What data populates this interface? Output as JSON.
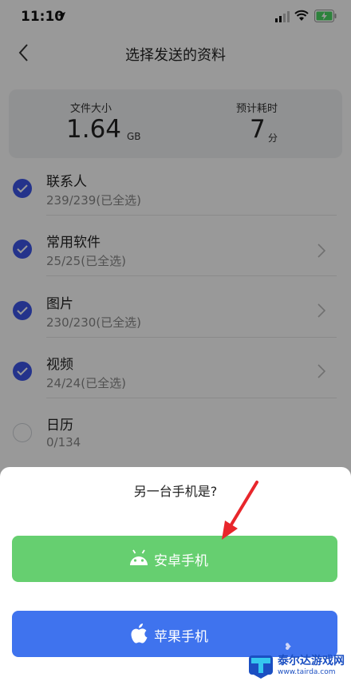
{
  "status_bar": {
    "time": "11:10"
  },
  "header": {
    "title": "选择发送的资料"
  },
  "summary": {
    "size_label": "文件大小",
    "size_value": "1.64",
    "size_unit": "GB",
    "time_label": "预计耗时",
    "time_value": "7",
    "time_unit": "分"
  },
  "items": [
    {
      "title": "联系人",
      "subtitle": "239/239(已全选)",
      "checked": true,
      "has_chevron": false
    },
    {
      "title": "常用软件",
      "subtitle": "25/25(已全选)",
      "checked": true,
      "has_chevron": true
    },
    {
      "title": "图片",
      "subtitle": "230/230(已全选)",
      "checked": true,
      "has_chevron": true
    },
    {
      "title": "视频",
      "subtitle": "24/24(已全选)",
      "checked": true,
      "has_chevron": true
    },
    {
      "title": "日历",
      "subtitle": "0/134",
      "checked": false,
      "has_chevron": false
    }
  ],
  "sheet": {
    "title": "另一台手机是?",
    "android_label": "安卓手机",
    "apple_label": "苹果手机"
  },
  "colors": {
    "check_accent": "#3d56e8",
    "android_button": "#66cf70",
    "apple_button": "#3f73ee",
    "annotation_arrow": "#e8262b"
  },
  "watermark": {
    "text": "泰尔达游戏网",
    "url": "www.tairda.com"
  }
}
